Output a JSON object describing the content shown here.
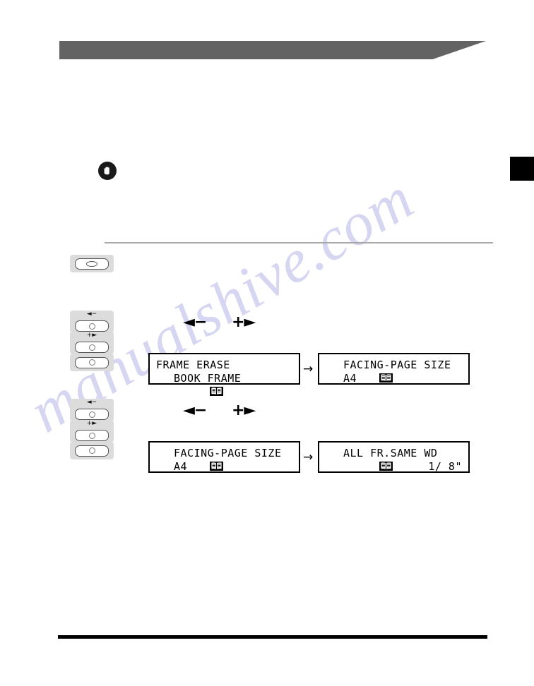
{
  "page": {
    "watermark": "manualshive.com",
    "header_bar_color": "#636363",
    "edge_tab_color": "#000000"
  },
  "notice": {
    "icon": "important-hand-icon"
  },
  "controls": {
    "reset_button": {
      "name": "reset-key",
      "icon": "oval-key-icon"
    },
    "groups": [
      {
        "id": "group-1",
        "keys": [
          {
            "name": "left-minus-key",
            "label": "◄−",
            "icon": "round-key-icon"
          },
          {
            "name": "right-plus-key",
            "label": "+►",
            "icon": "round-key-icon"
          },
          {
            "name": "ok-key",
            "label": "",
            "icon": "round-key-icon"
          }
        ],
        "arrow_caption_left": "◄−",
        "arrow_caption_right": "+►"
      },
      {
        "id": "group-2",
        "keys": [
          {
            "name": "left-minus-key",
            "label": "◄−",
            "icon": "round-key-icon"
          },
          {
            "name": "right-plus-key",
            "label": "+►",
            "icon": "round-key-icon"
          },
          {
            "name": "ok-key",
            "label": "",
            "icon": "round-key-icon"
          }
        ],
        "arrow_caption_left": "◄−",
        "arrow_caption_right": "+►"
      }
    ]
  },
  "flow": {
    "arrow_glyph": "→",
    "rows": [
      {
        "id": "row-1",
        "before": {
          "line1": "FRAME ERASE",
          "line1_icon": "",
          "line2": "BOOK FRAME",
          "line2_icon": "book-icon",
          "line2_align": "left"
        },
        "after": {
          "line1": "FACING-PAGE SIZE",
          "line1_icon": "book-icon",
          "line2": "A4",
          "line2_icon": "",
          "line2_align": "left"
        }
      },
      {
        "id": "row-2",
        "before": {
          "line1": "FACING-PAGE SIZE",
          "line1_icon": "book-icon",
          "line2": "A4",
          "line2_icon": "",
          "line2_align": "left"
        },
        "after": {
          "line1": "ALL FR.SAME WD",
          "line1_icon": "book-icon",
          "line2": "1/ 8\"",
          "line2_icon": "",
          "line2_align": "right"
        }
      }
    ]
  }
}
